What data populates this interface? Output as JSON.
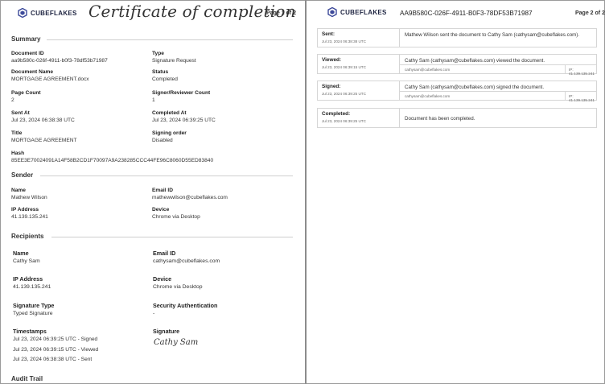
{
  "brand": {
    "name": "CUBEFLAKES",
    "color": "#3d4a9a"
  },
  "page1": {
    "title": "Certificate of completion",
    "page_label": "Page 1 of 2",
    "summary": {
      "heading": "Summary",
      "document_id_label": "Document ID",
      "document_id": "aa9b580c-026f-4911-b0f3-78df53b71987",
      "type_label": "Type",
      "type": "Signature Request",
      "document_name_label": "Document Name",
      "document_name": "MORTGAGE AGREEMENT.docx",
      "status_label": "Status",
      "status": "Completed",
      "page_count_label": "Page Count",
      "page_count": "2",
      "signer_count_label": "Signer/Reviewer Count",
      "signer_count": "1",
      "sent_at_label": "Sent At",
      "sent_at": "Jul 23, 2024 06:38:38 UTC",
      "completed_at_label": "Completed At",
      "completed_at": "Jul 23, 2024 06:39:25 UTC",
      "title_label": "Title",
      "title": "MORTGAGE AGREEMENT",
      "signing_order_label": "Signing order",
      "signing_order": "Disabled",
      "hash_label": "Hash",
      "hash": "85EE3E70024091A14F58B2CD1F70097A9A238285CCC44FE96C8060D55ED83840"
    },
    "sender": {
      "heading": "Sender",
      "name_label": "Name",
      "name": "Mathew Wilson",
      "email_label": "Email ID",
      "email": "mathewwilson@cubeflakes.com",
      "ip_label": "IP Address",
      "ip": "41.139.135.241",
      "device_label": "Device",
      "device": "Chrome via Desktop"
    },
    "recipients": {
      "heading": "Recipients",
      "name_label": "Name",
      "name": "Cathy Sam",
      "email_label": "Email ID",
      "email": "cathysam@cubeflakes.com",
      "ip_label": "IP Address",
      "ip": "41.139.135.241",
      "device_label": "Device",
      "device": "Chrome via Desktop",
      "sig_type_label": "Signature Type",
      "sig_type": "Typed Signature",
      "security_label": "Security Authentication",
      "security": "-",
      "timestamps_label": "Timestamps",
      "timestamps": [
        "Jul 23, 2024 06:39:25 UTC - Signed",
        "Jul 23, 2024 06:39:15 UTC - Viewed",
        "Jul 23, 2024 06:38:38 UTC - Sent"
      ],
      "signature_label": "Signature",
      "signature": "Cathy Sam"
    },
    "audit_heading": "Audit Trail"
  },
  "page2": {
    "document_id": "AA9B580C-026F-4911-B0F3-78DF53B71987",
    "page_label": "Page 2 of 2",
    "events": [
      {
        "name": "Sent:",
        "time": "Jul 23, 2024 06:38:38 UTC",
        "message": "Mathew Wilson sent the document to Cathy Sam (cathysam@cubeflakes.com).",
        "email": "",
        "ip": ""
      },
      {
        "name": "Viewed:",
        "time": "Jul 23, 2024 06:39:15 UTC",
        "message": "Cathy Sam (cathysam@cubeflakes.com) viewed the document.",
        "email": "cathysam@cubeflakes.com",
        "ip": "IP: 41.139.135.241"
      },
      {
        "name": "Signed:",
        "time": "Jul 23, 2024 06:39:25 UTC",
        "message": "Cathy Sam (cathysam@cubeflakes.com) signed the document.",
        "email": "cathysam@cubeflakes.com",
        "ip": "IP: 41.139.135.241"
      },
      {
        "name": "Completed:",
        "time": "Jul 23, 2024 06:39:25 UTC",
        "message": "Document has been completed.",
        "email": "",
        "ip": ""
      }
    ]
  }
}
